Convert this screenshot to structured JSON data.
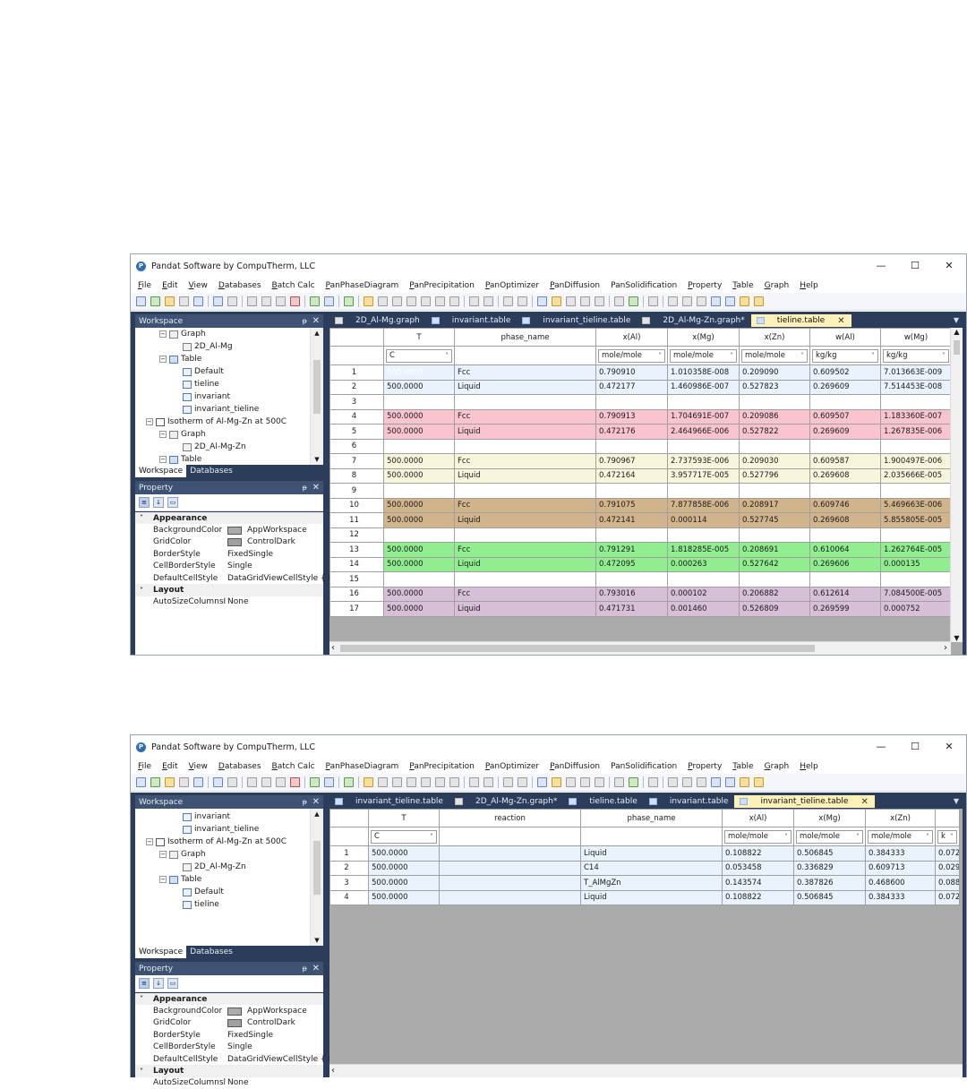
{
  "window": {
    "title": "Pandat Software by CompuTherm, LLC",
    "minimize": "—",
    "maximize": "☐",
    "close": "✕"
  },
  "menu": [
    {
      "acc": "F",
      "rest": "ile"
    },
    {
      "acc": "E",
      "rest": "dit"
    },
    {
      "acc": "V",
      "rest": "iew"
    },
    {
      "acc": "D",
      "rest": "atabases"
    },
    {
      "acc": "B",
      "rest": "atch Calc"
    },
    {
      "acc": "P",
      "rest": "anPhaseDiagram"
    },
    {
      "acc": "P",
      "rest": "anPrecipitation"
    },
    {
      "acc": "P",
      "rest": "anOptimizer"
    },
    {
      "acc": "P",
      "rest": "anDiffusion"
    },
    {
      "acc": "",
      "rest": "PanSolidification"
    },
    {
      "acc": "P",
      "rest": "roperty"
    },
    {
      "acc": "T",
      "rest": "able"
    },
    {
      "acc": "G",
      "rest": "raph"
    },
    {
      "acc": "H",
      "rest": "elp"
    }
  ],
  "panels": {
    "workspace_title": "Workspace",
    "workspace_tab": "Workspace",
    "databases_tab": "Databases",
    "property_title": "Property",
    "pin": "ᵽ",
    "close": "✕"
  },
  "properties": {
    "appearance": "Appearance",
    "layout": "Layout",
    "rows": [
      {
        "name": "BackgroundColor",
        "value": "AppWorkspace",
        "swatch": "#ababab"
      },
      {
        "name": "GridColor",
        "value": "ControlDark",
        "swatch": "#a0a0a0"
      },
      {
        "name": "BorderStyle",
        "value": "FixedSingle"
      },
      {
        "name": "CellBorderStyle",
        "value": "Single"
      },
      {
        "name": "DefaultCellStyle",
        "value": "DataGridViewCellStyle { B"
      }
    ],
    "layout_row": {
      "name1": "AutoSizeColumnsI",
      "name2": "AutoSizeColumnsl",
      "value": "None"
    }
  },
  "screen1": {
    "tree": [
      {
        "label": "Graph",
        "indent": 2,
        "icon": "graph",
        "exp": "−"
      },
      {
        "label": "2D_Al-Mg",
        "indent": 3,
        "icon": "graph"
      },
      {
        "label": "Table",
        "indent": 2,
        "icon": "folder",
        "exp": "−"
      },
      {
        "label": "Default",
        "indent": 3,
        "icon": "table"
      },
      {
        "label": "tieline",
        "indent": 3,
        "icon": "table"
      },
      {
        "label": "invariant",
        "indent": 3,
        "icon": "table"
      },
      {
        "label": "invariant_tieline",
        "indent": 3,
        "icon": "table"
      },
      {
        "label": "Isotherm of Al-Mg-Zn at 500C",
        "indent": 1,
        "icon": "iso",
        "exp": "−"
      },
      {
        "label": "Graph",
        "indent": 2,
        "icon": "graph",
        "exp": "−"
      },
      {
        "label": "2D_Al-Mg-Zn",
        "indent": 3,
        "icon": "graph"
      },
      {
        "label": "Table",
        "indent": 2,
        "icon": "folder",
        "exp": "−"
      }
    ],
    "tabs": [
      {
        "label": "2D_Al-Mg.graph",
        "icon": "graph"
      },
      {
        "label": "invariant.table",
        "icon": "table"
      },
      {
        "label": "invariant_tieline.table",
        "icon": "table"
      },
      {
        "label": "2D_Al-Mg-Zn.graph*",
        "icon": "graph"
      },
      {
        "label": "tieline.table",
        "icon": "table",
        "active": true
      }
    ],
    "columns": [
      "T",
      "phase_name",
      "x(Al)",
      "x(Mg)",
      "x(Zn)",
      "w(Al)",
      "w(Mg)"
    ],
    "units": [
      "C",
      "",
      "mole/mole",
      "mole/mole",
      "mole/mole",
      "kg/kg",
      "kg/kg"
    ],
    "rows": [
      {
        "n": "1",
        "bg": "#e8f3fd",
        "cells": [
          "500.0000",
          "Fcc",
          "0.790910",
          "1.010358E-008",
          "0.209090",
          "0.609502",
          "7.013663E-009"
        ]
      },
      {
        "n": "2",
        "bg": "#e8f3fd",
        "cells": [
          "500.0000",
          "Liquid",
          "0.472177",
          "1.460986E-007",
          "0.527823",
          "0.269609",
          "7.514453E-008"
        ]
      },
      {
        "n": "3",
        "bg": "#ffffff",
        "cells": [
          "",
          "",
          "",
          "",
          "",
          "",
          ""
        ]
      },
      {
        "n": "4",
        "bg": "#f9c3cf",
        "cells": [
          "500.0000",
          "Fcc",
          "0.790913",
          "1.704691E-007",
          "0.209086",
          "0.609507",
          "1.183360E-007"
        ]
      },
      {
        "n": "5",
        "bg": "#f9c3cf",
        "cells": [
          "500.0000",
          "Liquid",
          "0.472176",
          "2.464966E-006",
          "0.527822",
          "0.269609",
          "1.267835E-006"
        ]
      },
      {
        "n": "6",
        "bg": "#ffffff",
        "cells": [
          "",
          "",
          "",
          "",
          "",
          "",
          ""
        ]
      },
      {
        "n": "7",
        "bg": "#f8f5dd",
        "cells": [
          "500.0000",
          "Fcc",
          "0.790967",
          "2.737593E-006",
          "0.209030",
          "0.609587",
          "1.900497E-006"
        ]
      },
      {
        "n": "8",
        "bg": "#f8f5dd",
        "cells": [
          "500.0000",
          "Liquid",
          "0.472164",
          "3.957717E-005",
          "0.527796",
          "0.269608",
          "2.035666E-005"
        ]
      },
      {
        "n": "9",
        "bg": "#ffffff",
        "cells": [
          "",
          "",
          "",
          "",
          "",
          "",
          ""
        ]
      },
      {
        "n": "10",
        "bg": "#d2b48c",
        "cells": [
          "500.0000",
          "Fcc",
          "0.791075",
          "7.877858E-006",
          "0.208917",
          "0.609746",
          "5.469663E-006"
        ]
      },
      {
        "n": "11",
        "bg": "#d2b48c",
        "cells": [
          "500.0000",
          "Liquid",
          "0.472141",
          "0.000114",
          "0.527745",
          "0.269608",
          "5.855805E-005"
        ]
      },
      {
        "n": "12",
        "bg": "#ffffff",
        "cells": [
          "",
          "",
          "",
          "",
          "",
          "",
          ""
        ]
      },
      {
        "n": "13",
        "bg": "#90ee90",
        "cells": [
          "500.0000",
          "Fcc",
          "0.791291",
          "1.818285E-005",
          "0.208691",
          "0.610064",
          "1.262764E-005"
        ]
      },
      {
        "n": "14",
        "bg": "#90ee90",
        "cells": [
          "500.0000",
          "Liquid",
          "0.472095",
          "0.000263",
          "0.527642",
          "0.269606",
          "0.000135"
        ]
      },
      {
        "n": "15",
        "bg": "#ffffff",
        "cells": [
          "",
          "",
          "",
          "",
          "",
          "",
          ""
        ]
      },
      {
        "n": "16",
        "bg": "#d8bfd8",
        "cells": [
          "500.0000",
          "Fcc",
          "0.793016",
          "0.000102",
          "0.206882",
          "0.612614",
          "7.084500E-005"
        ]
      },
      {
        "n": "17",
        "bg": "#d8bfd8",
        "cells": [
          "500.0000",
          "Liquid",
          "0.471731",
          "0.001460",
          "0.526809",
          "0.269599",
          "0.000752"
        ]
      }
    ]
  },
  "screen2": {
    "tree": [
      {
        "label": "invariant",
        "indent": 3,
        "icon": "table"
      },
      {
        "label": "invariant_tieline",
        "indent": 3,
        "icon": "table"
      },
      {
        "label": "Isotherm of Al-Mg-Zn at 500C",
        "indent": 1,
        "icon": "iso",
        "exp": "−"
      },
      {
        "label": "Graph",
        "indent": 2,
        "icon": "graph",
        "exp": "−"
      },
      {
        "label": "2D_Al-Mg-Zn",
        "indent": 3,
        "icon": "graph"
      },
      {
        "label": "Table",
        "indent": 2,
        "icon": "folder",
        "exp": "−"
      },
      {
        "label": "Default",
        "indent": 3,
        "icon": "table"
      },
      {
        "label": "tieline",
        "indent": 3,
        "icon": "table"
      }
    ],
    "tabs": [
      {
        "label": "invariant_tieline.table",
        "icon": "table"
      },
      {
        "label": "2D_Al-Mg-Zn.graph*",
        "icon": "graph"
      },
      {
        "label": "tieline.table",
        "icon": "table"
      },
      {
        "label": "invariant.table",
        "icon": "table"
      },
      {
        "label": "invariant_tieline.table",
        "icon": "table",
        "active": true
      }
    ],
    "columns": [
      "T",
      "reaction",
      "phase_name",
      "x(Al)",
      "x(Mg)",
      "x(Zn)",
      ""
    ],
    "units": [
      "C",
      "",
      "",
      "mole/mole",
      "mole/mole",
      "mole/mole",
      "k"
    ],
    "rows": [
      {
        "n": "1",
        "bg": "#e8f3fd",
        "cells": [
          "500.0000",
          "",
          "Liquid",
          "0.108822",
          "0.506845",
          "0.384333",
          "0.072"
        ]
      },
      {
        "n": "2",
        "bg": "#e8f3fd",
        "cells": [
          "500.0000",
          "",
          "C14",
          "0.053458",
          "0.336829",
          "0.609713",
          "0.029"
        ]
      },
      {
        "n": "3",
        "bg": "#e8f3fd",
        "cells": [
          "500.0000",
          "",
          "T_AlMgZn",
          "0.143574",
          "0.387826",
          "0.468600",
          "0.088"
        ]
      },
      {
        "n": "4",
        "bg": "#e8f3fd",
        "cells": [
          "500.0000",
          "",
          "Liquid",
          "0.108822",
          "0.506845",
          "0.384333",
          "0.072"
        ]
      }
    ]
  }
}
